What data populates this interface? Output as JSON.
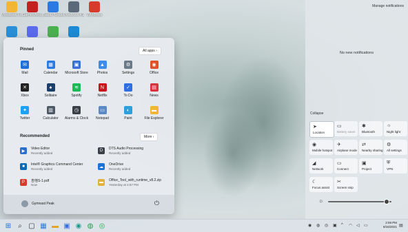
{
  "desktop": {
    "icons": [
      {
        "label": "Windows Fil...",
        "icon": "folder-icon",
        "color": "#f2b632"
      },
      {
        "label": "GamesAndi...",
        "icon": "vlc-icon",
        "color": "#c32020"
      },
      {
        "label": "Baidu Netdisk",
        "icon": "cloud-icon",
        "color": "#2a7ae2"
      },
      {
        "label": "Windows KE...",
        "icon": "tools-icon",
        "color": "#5a6a7a"
      },
      {
        "label": "Windows",
        "icon": "pdf-icon",
        "color": "#d83b2b"
      },
      {
        "label": "",
        "icon": "app-icon",
        "color": "#2a8fd6"
      },
      {
        "label": "",
        "icon": "browser-icon",
        "color": "#5b6bf0"
      },
      {
        "label": "",
        "icon": "package-icon",
        "color": "#4caf50"
      },
      {
        "label": "",
        "icon": "bolt-icon",
        "color": "#1d8ad6"
      }
    ]
  },
  "start_menu": {
    "pinned_title": "Pinned",
    "all_apps_label": "All apps  ›",
    "pinned": [
      {
        "label": "Mail",
        "icon": "mail-icon",
        "color": "#1e6fd9",
        "glyph": "✉"
      },
      {
        "label": "Calendar",
        "icon": "calendar-icon",
        "color": "#2a7ae2",
        "glyph": "▦"
      },
      {
        "label": "Microsoft Store",
        "icon": "store-icon",
        "color": "#3b6fd8",
        "glyph": "▣"
      },
      {
        "label": "Photos",
        "icon": "photos-icon",
        "color": "#3d8de8",
        "glyph": "▲"
      },
      {
        "label": "Settings",
        "icon": "gear-icon",
        "color": "#6b7a88",
        "glyph": "⚙"
      },
      {
        "label": "Office",
        "icon": "office-icon",
        "color": "#e0502a",
        "glyph": "◉"
      },
      {
        "label": "Xbox",
        "icon": "xbox-icon",
        "color": "#222",
        "glyph": "✕"
      },
      {
        "label": "Solitaire",
        "icon": "solitaire-icon",
        "color": "#1b3f6b",
        "glyph": "♠"
      },
      {
        "label": "Spotify",
        "icon": "spotify-icon",
        "color": "#1db954",
        "glyph": "≋"
      },
      {
        "label": "Netflix",
        "icon": "netflix-icon",
        "color": "#c4161c",
        "glyph": "N"
      },
      {
        "label": "To Do",
        "icon": "todo-icon",
        "color": "#2f6fe0",
        "glyph": "✓"
      },
      {
        "label": "News",
        "icon": "news-icon",
        "color": "#d8333f",
        "glyph": "▤"
      },
      {
        "label": "Twitter",
        "icon": "twitter-icon",
        "color": "#1da1f2",
        "glyph": "✦"
      },
      {
        "label": "Calculator",
        "icon": "calculator-icon",
        "color": "#4c5866",
        "glyph": "▥"
      },
      {
        "label": "Alarms & Clock",
        "icon": "clock-icon",
        "color": "#3a3f47",
        "glyph": "◷"
      },
      {
        "label": "Notepad",
        "icon": "notepad-icon",
        "color": "#5c88c4",
        "glyph": "▭"
      },
      {
        "label": "Paint",
        "icon": "paint-icon",
        "color": "#2da0dc",
        "glyph": "◐"
      },
      {
        "label": "File Explorer",
        "icon": "folder-icon",
        "color": "#f2b632",
        "glyph": "▬"
      }
    ],
    "recommended_title": "Recommended",
    "more_label": "More  ›",
    "recommended": [
      {
        "name": "Video Editor",
        "sub": "Recently added",
        "icon": "video-editor-icon",
        "color": "#2a6fd0",
        "glyph": "▶"
      },
      {
        "name": "DTS Audio Processing",
        "sub": "Recently added",
        "icon": "dts-icon",
        "color": "#3a3f47",
        "glyph": "D"
      },
      {
        "name": "Intel® Graphics Command Center",
        "sub": "Recently added",
        "icon": "intel-icon",
        "color": "#0a6ab8",
        "glyph": "■"
      },
      {
        "name": "OneDrive",
        "sub": "Recently added",
        "icon": "onedrive-icon",
        "color": "#1a73d8",
        "glyph": "☁"
      },
      {
        "name": "吉他S-1.pdf",
        "sub": "Now",
        "icon": "pdf-icon",
        "color": "#d83b2b",
        "glyph": "P"
      },
      {
        "name": "Office_Tool_with_runtime_v8.2.zip",
        "sub": "Yesterday at 4:57 PM",
        "icon": "zip-icon",
        "color": "#e2b23a",
        "glyph": "▬"
      }
    ],
    "user_name": "Gymnast Peak"
  },
  "panel": {
    "manage_label": "Manage notifications",
    "empty_label": "No new notifications",
    "collapse_label": "Collapse",
    "quick_settings": [
      {
        "label": "Location",
        "icon": "location-icon",
        "glyph": "➤",
        "on": true,
        "dim": false
      },
      {
        "label": "Battery saver",
        "icon": "battery-icon",
        "glyph": "▭",
        "on": false,
        "dim": true
      },
      {
        "label": "Bluetooth",
        "icon": "bluetooth-icon",
        "glyph": "✱",
        "on": false,
        "dim": false
      },
      {
        "label": "Night light",
        "icon": "night-light-icon",
        "glyph": "☼",
        "on": false,
        "dim": false
      },
      {
        "label": "Mobile hotspot",
        "icon": "hotspot-icon",
        "glyph": "◉",
        "on": false,
        "dim": false
      },
      {
        "label": "Airplane mode",
        "icon": "airplane-icon",
        "glyph": "✈",
        "on": false,
        "dim": false
      },
      {
        "label": "Nearby sharing",
        "icon": "nearby-sharing-icon",
        "glyph": "⇄",
        "on": false,
        "dim": false
      },
      {
        "label": "All settings",
        "icon": "gear-icon",
        "glyph": "⚙",
        "on": false,
        "dim": false
      },
      {
        "label": "Network",
        "icon": "network-icon",
        "glyph": "◢",
        "on": false,
        "dim": false
      },
      {
        "label": "Connect",
        "icon": "connect-icon",
        "glyph": "▭",
        "on": false,
        "dim": false
      },
      {
        "label": "Project",
        "icon": "project-icon",
        "glyph": "▣",
        "on": false,
        "dim": false
      },
      {
        "label": "VPN",
        "icon": "vpn-icon",
        "glyph": "⛨",
        "on": false,
        "dim": false
      },
      {
        "label": "Focus assist",
        "icon": "focus-assist-icon",
        "glyph": "☾",
        "on": false,
        "dim": false
      },
      {
        "label": "Screen snip",
        "icon": "screen-snip-icon",
        "glyph": "✂",
        "on": false,
        "dim": false
      }
    ],
    "brightness": 0.92
  },
  "taskbar": {
    "icons": [
      {
        "name": "start-icon",
        "glyph": "⊞",
        "color": "#1e6fd9"
      },
      {
        "name": "search-icon",
        "glyph": "⌕",
        "color": "#333"
      },
      {
        "name": "task-view-icon",
        "glyph": "▢",
        "color": "#333"
      },
      {
        "name": "widgets-icon",
        "glyph": "▦",
        "color": "#2a7ae2"
      },
      {
        "name": "folder-icon",
        "glyph": "▬",
        "color": "#e2a62a"
      },
      {
        "name": "store-icon",
        "glyph": "▣",
        "color": "#3b6fd8"
      },
      {
        "name": "edge-icon",
        "glyph": "◉",
        "color": "#1d9a8a"
      },
      {
        "name": "chrome-icon",
        "glyph": "◍",
        "color": "#2a9a48"
      },
      {
        "name": "wechat-icon",
        "glyph": "◎",
        "color": "#2ab34a"
      }
    ],
    "time": "2:59 PM",
    "date": "8/16/2021"
  }
}
